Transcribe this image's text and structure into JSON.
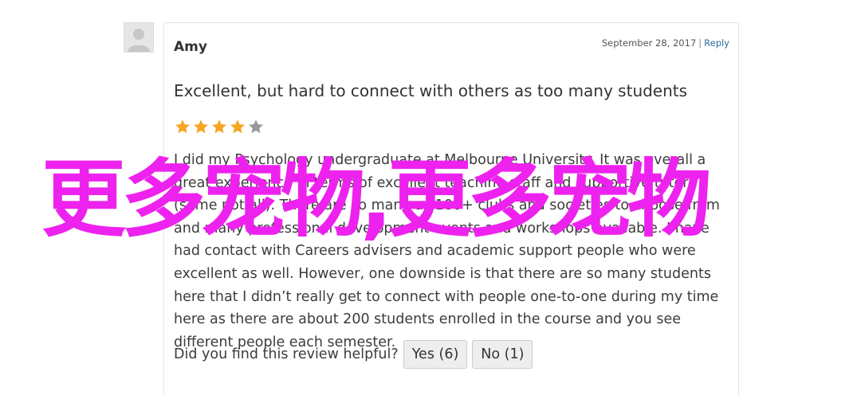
{
  "review": {
    "author": "Amy",
    "date": "September 28, 2017",
    "separator": "|",
    "reply_label": "Reply",
    "title": "Excellent, but hard to connect with others as too many students",
    "rating": 4,
    "rating_max": 5,
    "star_color_filled": "#f5a623",
    "star_color_empty": "#999999",
    "body": "I did my Psychology undergraduate at Melbourne University. It was overall a great experience in terms of excellent teaching staff and supportive tutors (some not all). There are so many as 100+ clubs and societies to choose from and many professional development events and workshops available. I have had contact with Careers advisers and academic support people who were excellent as well. However, one downside is that there are so many students here that I didn’t really get to connect with people one-to-one during my time here as there are about 200 students enrolled in the course and you see different people each semester.",
    "helpful_prompt": "Did you find this review helpful?",
    "yes_label": "Yes (6)",
    "no_label": "No (1)"
  },
  "overlay": {
    "text": "更多宠物,更多宠物",
    "color": "#ee22ee"
  },
  "icons": {
    "avatar": "default-avatar-icon",
    "star": "star-icon"
  }
}
